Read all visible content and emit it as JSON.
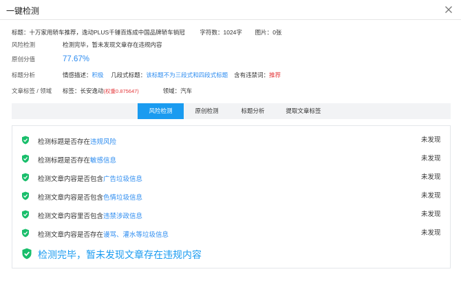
{
  "dialog": {
    "title": "一键检测"
  },
  "meta": {
    "title_label": "标题：",
    "title_value": "十万家用轿车推荐，逸动PLUS千锤百炼成中国品牌轿车销冠",
    "wordcount_label": "字符数：",
    "wordcount_value": "1024字",
    "images_label": "图片：",
    "images_value": "0张"
  },
  "risk": {
    "label": "风险检测",
    "value": "检测完毕，暂未发现文章存在违规内容"
  },
  "original": {
    "label": "原创分值",
    "value": "77.67%"
  },
  "title_analysis": {
    "label": "标题分析",
    "emotion_label": "情感描述：",
    "emotion_value": "积极",
    "segment_label": "几段式标题：",
    "segment_value": "该标题不为三段式和四段式标题",
    "banned_label": "含有违禁词：",
    "banned_value": "推荐"
  },
  "tags": {
    "label": "文章标签 / 领域",
    "tag_label": "标签：",
    "tag_value": "长安逸动",
    "tag_weight": "(权重0.875647)",
    "domain_label": "领域：",
    "domain_value": "汽车"
  },
  "tabs": [
    {
      "label": "风险检测",
      "active": true
    },
    {
      "label": "原创检测",
      "active": false
    },
    {
      "label": "标题分析",
      "active": false
    },
    {
      "label": "提取文章标签",
      "active": false
    }
  ],
  "checks": [
    {
      "prefix": "检测标题是否存在",
      "highlight": "违规风险",
      "status": "未发现"
    },
    {
      "prefix": "检测标题是否存在",
      "highlight": "敏感信息",
      "status": "未发现"
    },
    {
      "prefix": "检测文章内容是否包含",
      "highlight": "广告垃圾信息",
      "status": "未发现"
    },
    {
      "prefix": "检测文章内容是否包含",
      "highlight": "色情垃圾信息",
      "status": "未发现"
    },
    {
      "prefix": "检测文章内容里否包含",
      "highlight": "违禁涉政信息",
      "status": "未发现"
    },
    {
      "prefix": "检测文章内容是否存在",
      "highlight": "谩骂、灌水等垃圾信息",
      "status": "未发现"
    }
  ],
  "final_message": "检测完毕，暂未发现文章存在违规内容",
  "colors": {
    "accent": "#1a9bf0",
    "check_green": "#19be6b",
    "warning_red": "#e4393c"
  },
  "icons": {
    "close": "close-icon",
    "check": "check-shield-icon"
  }
}
